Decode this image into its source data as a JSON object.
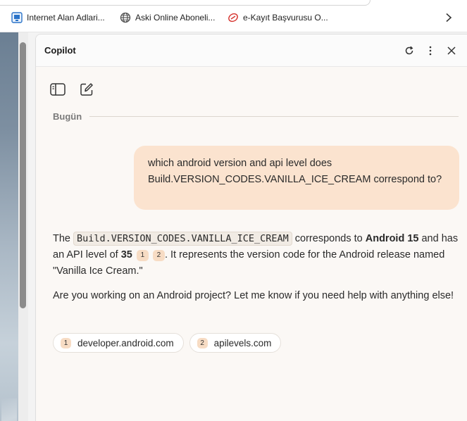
{
  "bookmarks": [
    {
      "label": "Internet Alan Adlari...",
      "icon": "site-icon-blue"
    },
    {
      "label": "Aski Online Aboneli...",
      "icon": "globe-icon"
    },
    {
      "label": "e-Kayıt Başvurusu O...",
      "icon": "ekayit-icon"
    }
  ],
  "panel": {
    "title": "Copilot",
    "day_label": "Bugün"
  },
  "conversation": {
    "user_message": "which android version and api level does Build.VERSION_CODES.VANILLA_ICE_CREAM correspond to?",
    "answer": {
      "p1_intro": "The ",
      "p1_code": "Build.VERSION_CODES.VANILLA_ICE_CREAM",
      "p1_mid": " corresponds to ",
      "p1_android": "Android 15",
      "p1_api_intro": " and has an API level of ",
      "p1_api": "35",
      "p1_rest": ". It represents the version code for the Android release named \"Vanilla Ice Cream.\"",
      "p2": "Are you working on an Android project? Let me know if you need help with anything else!"
    },
    "citations": [
      {
        "num": "1",
        "source": "developer.android.com"
      },
      {
        "num": "2",
        "source": "apilevels.com"
      }
    ]
  },
  "colors": {
    "user_bubble": "#fbe3cf",
    "citation_badge": "#f7dcc4",
    "panel_bg": "#fbf8f5"
  }
}
